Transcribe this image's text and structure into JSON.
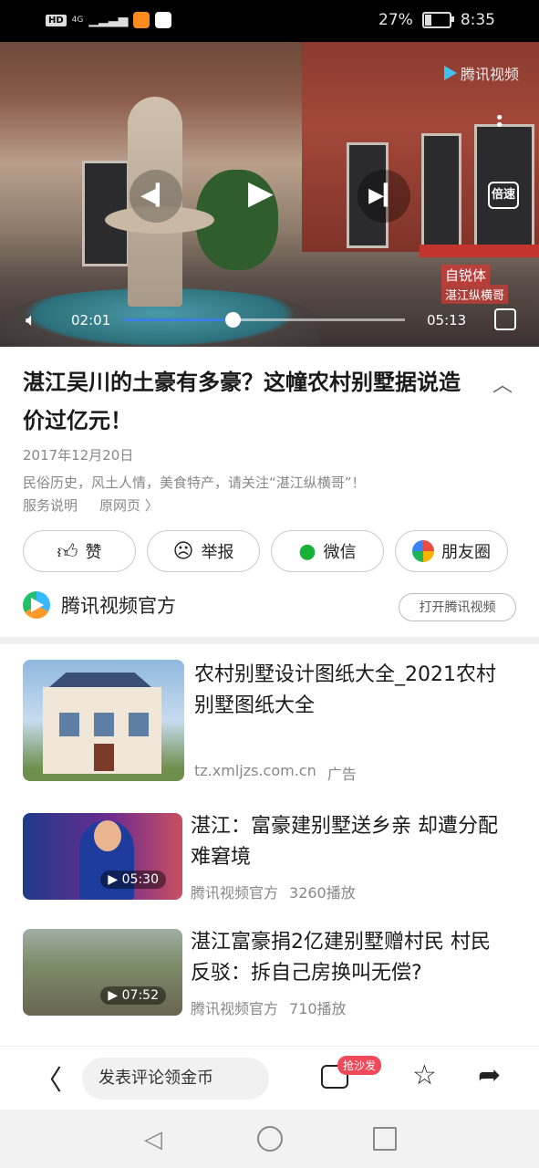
{
  "status_bar": {
    "hd": "HD",
    "signal": "4G",
    "battery_percent": "27%",
    "battery_level": 0.27,
    "time": "8:35"
  },
  "video": {
    "logo_text": "腾讯视频",
    "speed_label": "倍速",
    "watermark_top": "自锐体",
    "watermark_bottom": "湛江纵横哥",
    "current_time": "02:01",
    "total_time": "05:13",
    "progress": 0.387
  },
  "article": {
    "title": "湛江吴川的土豪有多豪？这幢农村别墅据说造价过亿元！",
    "date": "2017年12月20日",
    "description": "民俗历史，风土人情，美食特产，请关注“湛江纵横哥”！",
    "service_link": "服务说明",
    "source_link": "原网页 〉"
  },
  "actions": [
    {
      "label": "赞",
      "icon": "thumbs-up-icon"
    },
    {
      "label": "举报",
      "icon": "report-icon"
    },
    {
      "label": "微信",
      "icon": "wechat-icon"
    },
    {
      "label": "朋友圈",
      "icon": "moments-icon"
    }
  ],
  "channel": {
    "name": "腾讯视频官方",
    "open_button": "打开腾讯视频"
  },
  "feed": [
    {
      "title": "农村别墅设计图纸大全_2021农村别墅图纸大全",
      "source": "tz.xmljzs.com.cn",
      "tag": "广告"
    },
    {
      "title": "湛江：富豪建别墅送乡亲 却遭分配难窘境",
      "duration": "05:30",
      "source": "腾讯视频官方",
      "plays": "3260播放"
    },
    {
      "title": "湛江富豪捐2亿建别墅赠村民 村民反驳：拆自己房换叫无偿?",
      "duration": "07:52",
      "source": "腾讯视频官方",
      "plays": "710播放"
    }
  ],
  "bottom_bar": {
    "comment_placeholder": "发表评论领金币",
    "sofa_badge": "抢沙发"
  }
}
